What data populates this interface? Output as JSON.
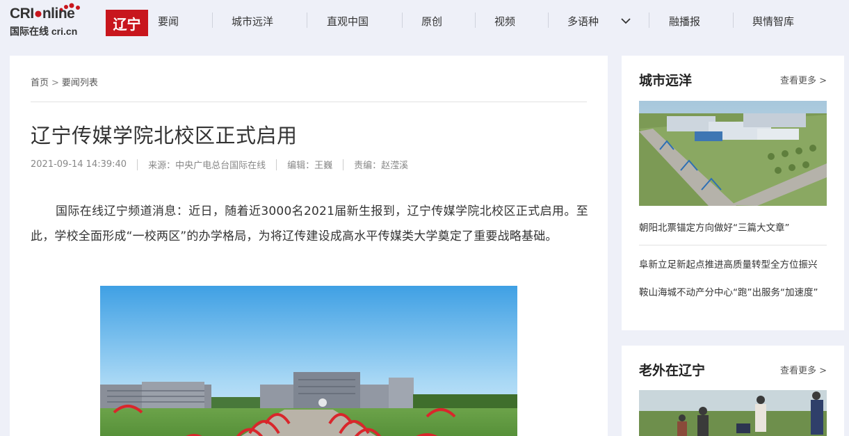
{
  "header": {
    "logo_brand_left": "CRI",
    "logo_brand_right": "nline",
    "logo_sub": "国际在线 cri.cn",
    "region": "辽宁",
    "nav": [
      {
        "label": "要闻"
      },
      {
        "label": "城市远洋"
      },
      {
        "label": "直观中国"
      },
      {
        "label": "原创"
      },
      {
        "label": "视频"
      },
      {
        "label": "多语种"
      },
      {
        "label": "融播报"
      },
      {
        "label": "舆情智库"
      }
    ]
  },
  "breadcrumb": {
    "home": "首页",
    "sep": ">",
    "current": "要闻列表"
  },
  "article": {
    "title": "辽宁传媒学院北校区正式启用",
    "datetime": "2021-09-14 14:39:40",
    "source": "来源：中央广电总台国际在线",
    "editor": "编辑：王巍",
    "chief_editor": "责编：赵滢溪",
    "paragraph": "国际在线辽宁频道消息：近日，随着近3000名2021届新生报到，辽宁传媒学院北校区正式启用。至此，学校全面形成“一校两区”的办学格局，为将辽传建设成高水平传媒类大学奠定了重要战略基础。"
  },
  "sidebar": {
    "section1": {
      "title": "城市远洋",
      "more": "查看更多 >",
      "caption": "朝阳北票锚定方向做好“三篇大文章”",
      "links": [
        "阜新立足新起点推进高质量转型全方位振兴",
        "鞍山海城不动产分中心“跑”出服务“加速度”"
      ]
    },
    "section2": {
      "title": "老外在辽宁",
      "more": "查看更多 >"
    }
  },
  "colors": {
    "brand_red": "#c8161d",
    "page_bg": "#eef0f8"
  },
  "icons": {
    "dropdown": "chevron-down-icon"
  }
}
